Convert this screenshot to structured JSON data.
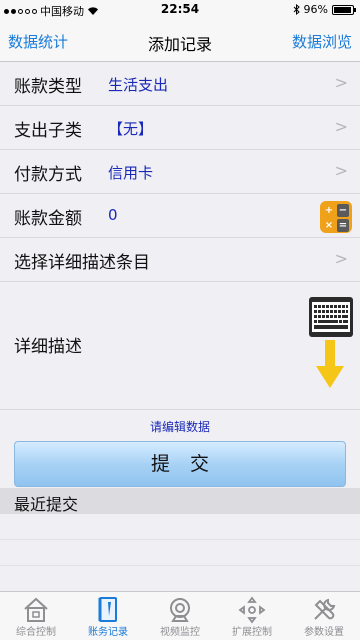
{
  "status": {
    "carrier": "中国移动",
    "time": "22:54",
    "battery": "96%"
  },
  "nav": {
    "left": "数据统计",
    "title": "添加记录",
    "right": "数据浏览"
  },
  "rows": [
    {
      "label": "账款类型",
      "value": "生活支出",
      "accessory": "chevron"
    },
    {
      "label": "支出子类",
      "value": "【无】",
      "accessory": "chevron"
    },
    {
      "label": "付款方式",
      "value": "信用卡",
      "accessory": "chevron"
    },
    {
      "label": "账款金额",
      "value": "0",
      "accessory": "calculator-icon"
    },
    {
      "label": "选择详细描述条目",
      "value": "",
      "accessory": "chevron"
    }
  ],
  "calc": {
    "plus": "+",
    "minus": "−",
    "times": "×",
    "equals": "="
  },
  "description": {
    "label": "详细描述"
  },
  "edit_hint": "请编辑数据",
  "submit_label": "提交",
  "recent": {
    "header": "最近提交"
  },
  "tabs": [
    {
      "label": "综合控制",
      "icon": "home-icon",
      "active": false
    },
    {
      "label": "账务记录",
      "icon": "notebook-icon",
      "active": true
    },
    {
      "label": "视频监控",
      "icon": "camera-icon",
      "active": false
    },
    {
      "label": "扩展控制",
      "icon": "arrows-icon",
      "active": false
    },
    {
      "label": "参数设置",
      "icon": "wrench-icon",
      "active": false
    }
  ],
  "colors": {
    "accent": "#1a7bd8",
    "value_text": "#1a28b8",
    "calc_orange": "#f0a11a",
    "arrow_yellow": "#f5c518"
  }
}
